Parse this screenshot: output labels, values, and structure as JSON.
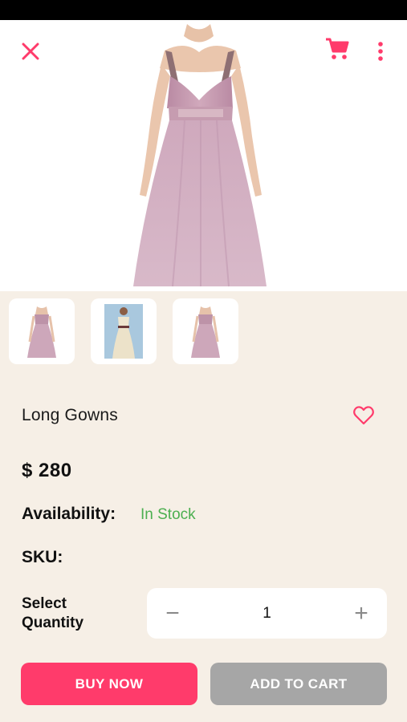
{
  "header": {
    "close_icon": "close-icon",
    "cart_icon": "cart-icon",
    "more_icon": "more-vertical-icon",
    "accent_color": "#ff3b6b"
  },
  "gallery": {
    "thumbnails": [
      {
        "label": "dress-thumb-1",
        "color": "#c9a3b6"
      },
      {
        "label": "dress-thumb-2",
        "color": "#e7dcc4"
      },
      {
        "label": "dress-thumb-3",
        "color": "#c9a3b6"
      }
    ]
  },
  "product": {
    "name": "Long Gowns",
    "price": "$ 280",
    "availability_label": "Availability:",
    "availability_value": "In Stock",
    "availability_color": "#4caf50",
    "sku_label": "SKU:",
    "sku_value": "",
    "favorite_icon": "heart-outline-icon"
  },
  "quantity": {
    "label": "Select Quantity",
    "value": "1",
    "minus": "−",
    "plus": "+"
  },
  "actions": {
    "buy_now": "BUY NOW",
    "add_to_cart": "ADD TO CART",
    "buy_color": "#ff3b6b",
    "cart_color": "#a6a6a6"
  }
}
